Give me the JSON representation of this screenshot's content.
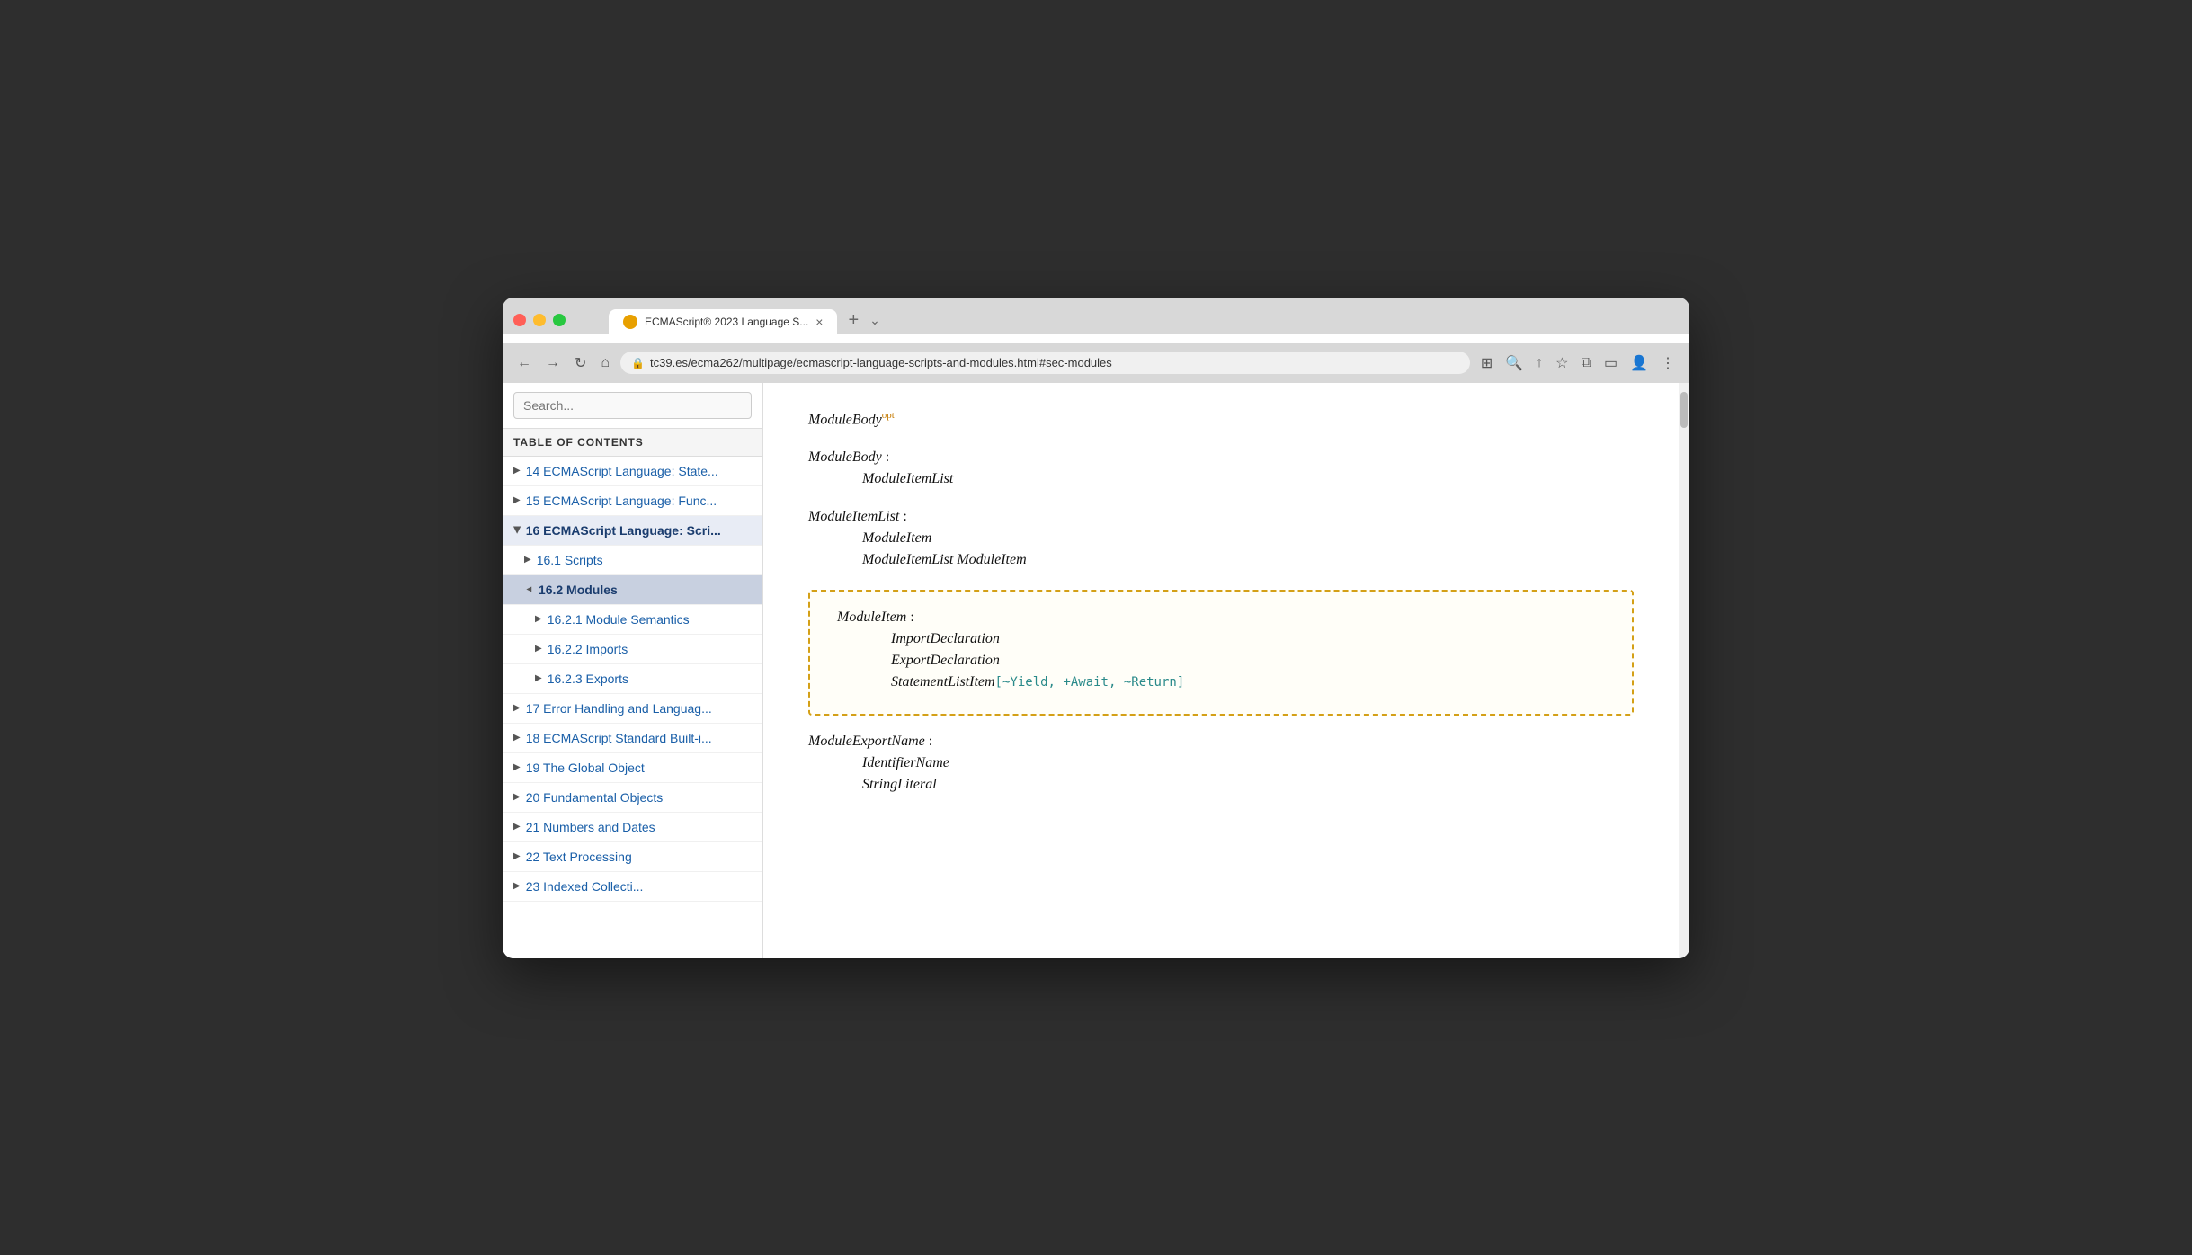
{
  "browser": {
    "tab_title": "ECMAScript® 2023 Language S...",
    "tab_close": "×",
    "tab_new": "+",
    "tab_expand": "⌄",
    "address": "tc39.es/ecma262/multipage/ecmascript-language-scripts-and-modules.html#sec-modules",
    "nav_back": "←",
    "nav_forward": "→",
    "nav_reload": "↻",
    "nav_home": "⌂"
  },
  "sidebar": {
    "search_placeholder": "Search...",
    "toc_header": "TABLE OF CONTENTS",
    "items": [
      {
        "id": "item-14",
        "label": "14 ECMAScript Language: State...",
        "level": 0,
        "expanded": false,
        "active": false
      },
      {
        "id": "item-15",
        "label": "15 ECMAScript Language: Func...",
        "level": 0,
        "expanded": false,
        "active": false
      },
      {
        "id": "item-16",
        "label": "16 ECMAScript Language: Scri...",
        "level": 0,
        "expanded": true,
        "active": true
      },
      {
        "id": "item-16-1",
        "label": "16.1 Scripts",
        "level": 1,
        "expanded": false,
        "active": false
      },
      {
        "id": "item-16-2",
        "label": "16.2 Modules",
        "level": 1,
        "expanded": true,
        "active": true
      },
      {
        "id": "item-16-2-1",
        "label": "16.2.1 Module Semantics",
        "level": 2,
        "expanded": false,
        "active": false
      },
      {
        "id": "item-16-2-2",
        "label": "16.2.2 Imports",
        "level": 2,
        "expanded": false,
        "active": false
      },
      {
        "id": "item-16-2-3",
        "label": "16.2.3 Exports",
        "level": 2,
        "expanded": false,
        "active": false
      },
      {
        "id": "item-17",
        "label": "17 Error Handling and Languag...",
        "level": 0,
        "expanded": false,
        "active": false
      },
      {
        "id": "item-18",
        "label": "18 ECMAScript Standard Built-i...",
        "level": 0,
        "expanded": false,
        "active": false
      },
      {
        "id": "item-19",
        "label": "19 The Global Object",
        "level": 0,
        "expanded": false,
        "active": false
      },
      {
        "id": "item-20",
        "label": "20 Fundamental Objects",
        "level": 0,
        "expanded": false,
        "active": false
      },
      {
        "id": "item-21",
        "label": "21 Numbers and Dates",
        "level": 0,
        "expanded": false,
        "active": false
      },
      {
        "id": "item-22",
        "label": "22 Text Processing",
        "level": 0,
        "expanded": false,
        "active": false
      },
      {
        "id": "item-23",
        "label": "23 Indexed Collecti...",
        "level": 0,
        "expanded": false,
        "active": false
      }
    ]
  },
  "content": {
    "module_body_opt": "ModuleBody",
    "module_body_opt_super": "opt",
    "module_body_label": "ModuleBody",
    "module_body_colon": ":",
    "module_body_item": "ModuleItemList",
    "module_item_list_label": "ModuleItemList",
    "module_item_list_colon": ":",
    "module_item_list_item1": "ModuleItem",
    "module_item_list_item2": "ModuleItemList  ModuleItem",
    "boxed_title": "ModuleItem",
    "boxed_colon": ":",
    "boxed_item1": "ImportDeclaration",
    "boxed_item2": "ExportDeclaration",
    "boxed_item3": "StatementListItem",
    "boxed_params": "[~Yield, +Await, ~Return]",
    "module_export_name_label": "ModuleExportName",
    "module_export_name_colon": ":",
    "module_export_name_item1": "IdentifierName",
    "module_export_name_item2": "StringLiteral"
  }
}
